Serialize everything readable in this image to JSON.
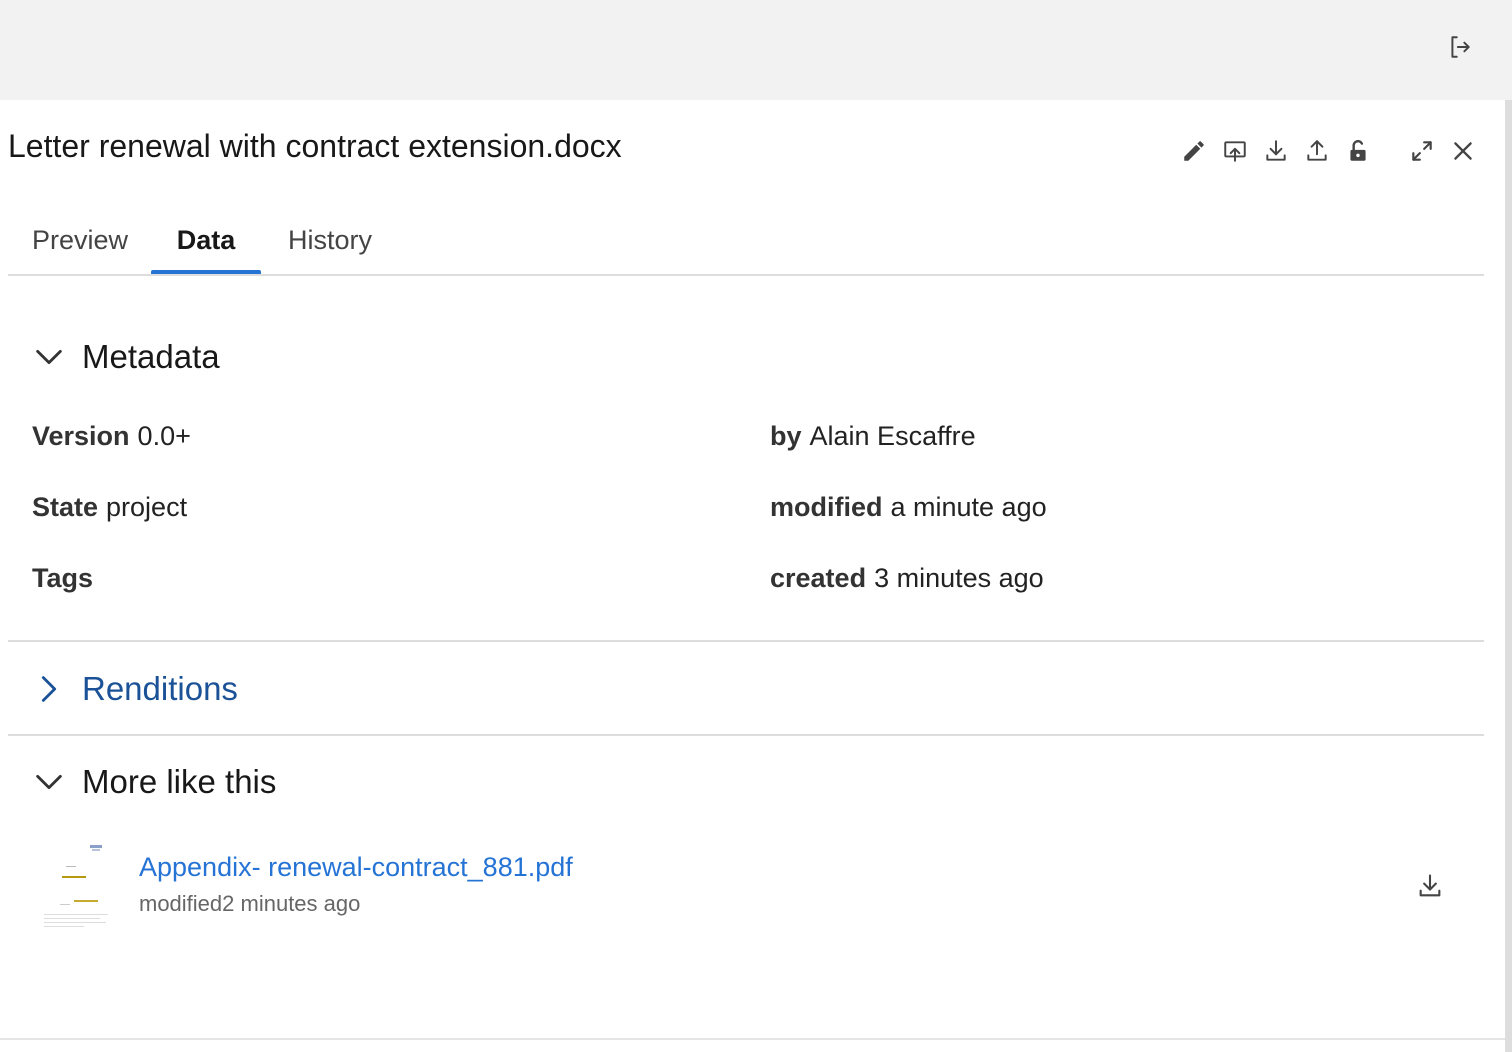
{
  "icons": {
    "logout": "logout-icon",
    "edit": "pencil-icon",
    "upload_new_version": "upload-new-version-icon",
    "download": "download-icon",
    "share": "share-icon",
    "unlock": "unlock-icon",
    "expand": "expand-icon",
    "close": "close-icon"
  },
  "panel": {
    "title": "Letter renewal with contract extension.docx"
  },
  "tabs": [
    {
      "label": "Preview",
      "active": false
    },
    {
      "label": "Data",
      "active": true
    },
    {
      "label": "History",
      "active": false
    }
  ],
  "colors": {
    "accent": "#2574d5",
    "link_dark": "#1b5297",
    "topbar_bg": "#f2f2f2",
    "divider": "#dddddd"
  },
  "metadata": {
    "heading": "Metadata",
    "expanded": true,
    "version_label": "Version",
    "version_value": "0.0+",
    "by_label": "by",
    "by_value": "Alain Escaffre",
    "state_label": "State",
    "state_value": "project",
    "modified_label": "modified",
    "modified_value": "a minute ago",
    "tags_label": "Tags",
    "tags_value": "",
    "created_label": "created",
    "created_value": "3 minutes ago"
  },
  "renditions": {
    "heading": "Renditions",
    "expanded": false
  },
  "more_like_this": {
    "heading": "More like this",
    "expanded": true,
    "items": [
      {
        "name": "Appendix- renewal-contract_881.pdf",
        "meta": "modified2 minutes ago"
      }
    ]
  }
}
